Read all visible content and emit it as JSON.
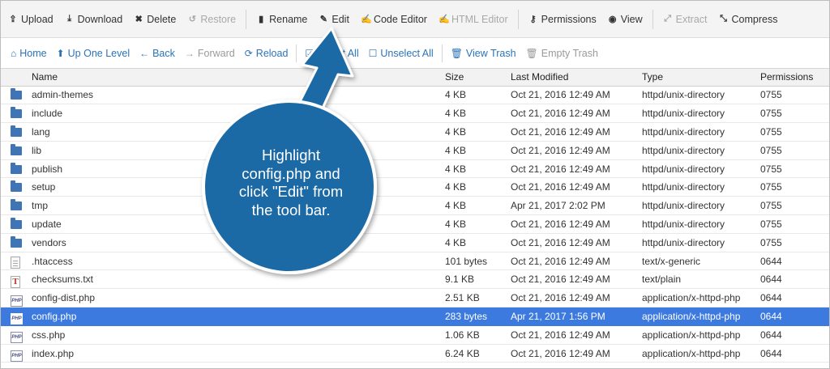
{
  "toolbar": {
    "items": [
      {
        "label": "Upload",
        "icon": "upload-icon",
        "glyph": "⇪",
        "disabled": false
      },
      {
        "label": "Download",
        "icon": "download-icon",
        "glyph": "⤓",
        "disabled": false
      },
      {
        "label": "Delete",
        "icon": "delete-icon",
        "glyph": "✖",
        "disabled": false
      },
      {
        "label": "Restore",
        "icon": "restore-icon",
        "glyph": "↺",
        "disabled": true
      },
      {
        "label": "Rename",
        "icon": "rename-icon",
        "glyph": "▮",
        "disabled": false
      },
      {
        "label": "Edit",
        "icon": "pencil-icon",
        "glyph": "✎",
        "disabled": false
      },
      {
        "label": "Code Editor",
        "icon": "code-editor-icon",
        "glyph": "✍",
        "disabled": false
      },
      {
        "label": "HTML Editor",
        "icon": "html-editor-icon",
        "glyph": "✍",
        "disabled": true
      },
      {
        "label": "Permissions",
        "icon": "key-icon",
        "glyph": "⚷",
        "disabled": false
      },
      {
        "label": "View",
        "icon": "eye-icon",
        "glyph": "◉",
        "disabled": false
      },
      {
        "label": "Extract",
        "icon": "extract-icon",
        "glyph": "⤢",
        "disabled": true
      },
      {
        "label": "Compress",
        "icon": "compress-icon",
        "glyph": "⤡",
        "disabled": false
      }
    ]
  },
  "navbar": {
    "items": [
      {
        "label": "Home",
        "icon": "home-icon",
        "glyph": "⌂",
        "disabled": false
      },
      {
        "label": "Up One Level",
        "icon": "level-up-icon",
        "glyph": "⬆",
        "disabled": false
      },
      {
        "label": "Back",
        "icon": "back-arrow-icon",
        "glyph": "←",
        "disabled": false
      },
      {
        "label": "Forward",
        "icon": "forward-arrow-icon",
        "glyph": "→",
        "disabled": true
      },
      {
        "label": "Reload",
        "icon": "reload-icon",
        "glyph": "⟳",
        "disabled": false
      },
      {
        "label": "Select All",
        "icon": "checkbox-checked-icon",
        "glyph": "☑",
        "disabled": false
      },
      {
        "label": "Unselect All",
        "icon": "checkbox-empty-icon",
        "glyph": "☐",
        "disabled": false
      },
      {
        "label": "View Trash",
        "icon": "trash-icon",
        "glyph": "🗑",
        "disabled": false
      },
      {
        "label": "Empty Trash",
        "icon": "trash-icon",
        "glyph": "🗑",
        "disabled": true
      }
    ]
  },
  "table": {
    "columns": [
      "Name",
      "Size",
      "Last Modified",
      "Type",
      "Permissions"
    ],
    "rows": [
      {
        "kind": "folder",
        "name": "admin-themes",
        "size": "4 KB",
        "modified": "Oct 21, 2016 12:49 AM",
        "type": "httpd/unix-directory",
        "perms": "0755"
      },
      {
        "kind": "folder",
        "name": "include",
        "size": "4 KB",
        "modified": "Oct 21, 2016 12:49 AM",
        "type": "httpd/unix-directory",
        "perms": "0755"
      },
      {
        "kind": "folder",
        "name": "lang",
        "size": "4 KB",
        "modified": "Oct 21, 2016 12:49 AM",
        "type": "httpd/unix-directory",
        "perms": "0755"
      },
      {
        "kind": "folder",
        "name": "lib",
        "size": "4 KB",
        "modified": "Oct 21, 2016 12:49 AM",
        "type": "httpd/unix-directory",
        "perms": "0755"
      },
      {
        "kind": "folder",
        "name": "publish",
        "size": "4 KB",
        "modified": "Oct 21, 2016 12:49 AM",
        "type": "httpd/unix-directory",
        "perms": "0755"
      },
      {
        "kind": "folder",
        "name": "setup",
        "size": "4 KB",
        "modified": "Oct 21, 2016 12:49 AM",
        "type": "httpd/unix-directory",
        "perms": "0755"
      },
      {
        "kind": "folder",
        "name": "tmp",
        "size": "4 KB",
        "modified": "Apr 21, 2017 2:02 PM",
        "type": "httpd/unix-directory",
        "perms": "0755"
      },
      {
        "kind": "folder",
        "name": "update",
        "size": "4 KB",
        "modified": "Oct 21, 2016 12:49 AM",
        "type": "httpd/unix-directory",
        "perms": "0755"
      },
      {
        "kind": "folder",
        "name": "vendors",
        "size": "4 KB",
        "modified": "Oct 21, 2016 12:49 AM",
        "type": "httpd/unix-directory",
        "perms": "0755"
      },
      {
        "kind": "doc",
        "name": ".htaccess",
        "size": "101 bytes",
        "modified": "Oct 21, 2016 12:49 AM",
        "type": "text/x-generic",
        "perms": "0644"
      },
      {
        "kind": "txt",
        "name": "checksums.txt",
        "size": "9.1 KB",
        "modified": "Oct 21, 2016 12:49 AM",
        "type": "text/plain",
        "perms": "0644"
      },
      {
        "kind": "php",
        "name": "config-dist.php",
        "size": "2.51 KB",
        "modified": "Oct 21, 2016 12:49 AM",
        "type": "application/x-httpd-php",
        "perms": "0644"
      },
      {
        "kind": "php",
        "name": "config.php",
        "size": "283 bytes",
        "modified": "Apr 21, 2017 1:56 PM",
        "type": "application/x-httpd-php",
        "perms": "0644",
        "selected": true
      },
      {
        "kind": "php",
        "name": "css.php",
        "size": "1.06 KB",
        "modified": "Oct 21, 2016 12:49 AM",
        "type": "application/x-httpd-php",
        "perms": "0644"
      },
      {
        "kind": "php",
        "name": "index.php",
        "size": "6.24 KB",
        "modified": "Oct 21, 2016 12:49 AM",
        "type": "application/x-httpd-php",
        "perms": "0644"
      }
    ]
  },
  "callout": {
    "lines": [
      "Highlight",
      "config.php and",
      "click \"Edit\" from",
      "the tool bar."
    ],
    "color": "#1f6aa5"
  },
  "colors": {
    "selection": "#3d7ae0",
    "link": "#2b73b8"
  }
}
